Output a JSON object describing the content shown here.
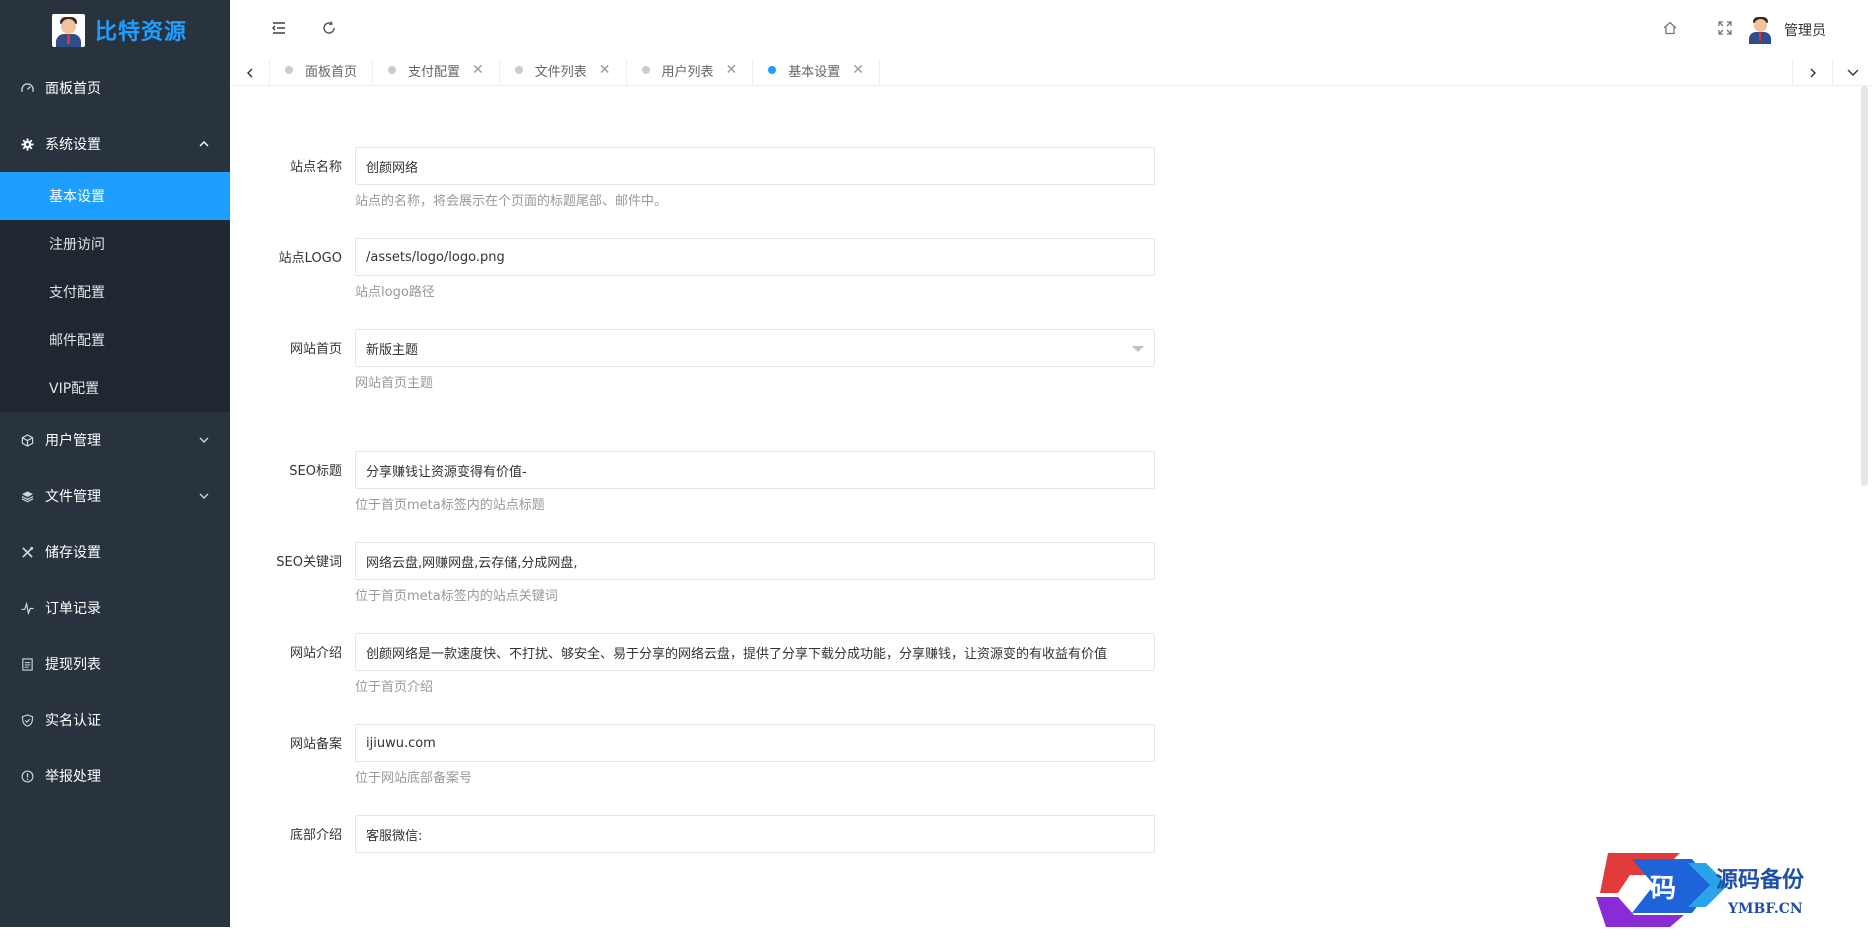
{
  "brand": {
    "title": "比特资源"
  },
  "sidebar": {
    "items": [
      {
        "label": "面板首页",
        "icon": "dashboard-icon"
      },
      {
        "label": "系统设置",
        "icon": "gear-icon",
        "expanded": true
      },
      {
        "label": "用户管理",
        "icon": "cube-icon"
      },
      {
        "label": "文件管理",
        "icon": "layers-icon"
      },
      {
        "label": "储存设置",
        "icon": "tools-icon"
      },
      {
        "label": "订单记录",
        "icon": "pulse-icon"
      },
      {
        "label": "提现列表",
        "icon": "list-icon"
      },
      {
        "label": "实名认证",
        "icon": "shield-check-icon"
      },
      {
        "label": "举报处理",
        "icon": "info-icon"
      }
    ],
    "subitems": [
      {
        "label": "基本设置",
        "active": true
      },
      {
        "label": "注册访问"
      },
      {
        "label": "支付配置"
      },
      {
        "label": "邮件配置"
      },
      {
        "label": "VIP配置"
      }
    ]
  },
  "header": {
    "admin_name": "管理员"
  },
  "tabs": [
    {
      "label": "面板首页",
      "closable": false
    },
    {
      "label": "支付配置",
      "closable": true
    },
    {
      "label": "文件列表",
      "closable": true
    },
    {
      "label": "用户列表",
      "closable": true
    },
    {
      "label": "基本设置",
      "closable": true,
      "active": true
    }
  ],
  "form": {
    "site_name": {
      "label": "站点名称",
      "value": "创颜网络",
      "hint": "站点的名称，将会展示在个页面的标题尾部、邮件中。"
    },
    "site_logo": {
      "label": "站点LOGO",
      "value": "/assets/logo/logo.png",
      "hint": "站点logo路径"
    },
    "homepage": {
      "label": "网站首页",
      "value": "新版主题",
      "hint": "网站首页主题"
    },
    "seo_title": {
      "label": "SEO标题",
      "value": "分享赚钱让资源变得有价值-",
      "hint": "位于首页meta标签内的站点标题"
    },
    "seo_keywords": {
      "label": "SEO关键词",
      "value": "网络云盘,网赚网盘,云存储,分成网盘,",
      "hint": "位于首页meta标签内的站点关键词"
    },
    "intro": {
      "label": "网站介绍",
      "value": "创颜网络是一款速度快、不打扰、够安全、易于分享的网络云盘，提供了分享下载分成功能，分享赚钱，让资源变的有收益有价值",
      "hint": "位于首页介绍"
    },
    "icp": {
      "label": "网站备案",
      "value": "ijiuwu.com",
      "hint": "位于网站底部备案号"
    },
    "footer": {
      "label": "底部介绍",
      "value": "客服微信:"
    }
  },
  "watermark": {
    "text": "源码备份",
    "domain": "YMBF.CN",
    "glyph": "码"
  },
  "colors": {
    "sidebar_bg": "#28333e",
    "submenu_bg": "#1f2731",
    "accent": "#1e9fff"
  }
}
